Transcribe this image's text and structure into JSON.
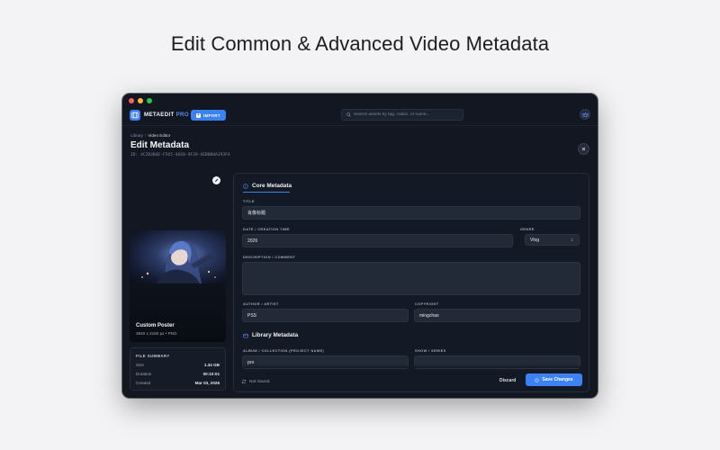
{
  "headline": "Edit Common & Advanced Video Metadata",
  "app": {
    "name_main": "METAEDIT",
    "name_pro": " PRO",
    "import_label": "IMPORT",
    "search_placeholder": "Search assets by tag, codec, or name..."
  },
  "breadcrumb": {
    "root": "Library",
    "separator": "/",
    "current": "Video Editor"
  },
  "page": {
    "title": "Edit Metadata",
    "id_text": "ID: 4C2B3B4E-F565-46E0-9F39-AEB8B8A393FA"
  },
  "poster": {
    "title": "Custom Poster",
    "subtitle": "3840 x 2160 px • PNG"
  },
  "file_summary": {
    "heading": "FILE SUMMARY",
    "rows": [
      {
        "key": "Size",
        "value": "1.34 GB"
      },
      {
        "key": "Duration",
        "value": "00:10:01"
      },
      {
        "key": "Created",
        "value": "Mar 03, 2026"
      }
    ]
  },
  "core": {
    "heading": "Core Metadata",
    "title_label": "TITLE",
    "title_value": "肖像标题",
    "date_label": "DATE / CREATION TIME",
    "date_value": "2026",
    "genre_label": "GENRE",
    "genre_value": "Vlog",
    "description_label": "DESCRIPTION / COMMENT",
    "description_value": "",
    "author_label": "AUTHOR / ARTIST",
    "author_value": "PSS",
    "copyright_label": "COPYRIGHT",
    "copyright_value": "mingchao"
  },
  "library": {
    "heading": "Library Metadata",
    "album_label": "ALBUM / COLLECTION (PROJECT NAME)",
    "album_value": "pro",
    "show_label": "SHOW / SERIES",
    "show_value": ""
  },
  "footer": {
    "status": "Not Saved",
    "discard": "Discard",
    "save": "Save Changes"
  },
  "colors": {
    "accent": "#3b82f6",
    "window_bg": "#121722",
    "panel_bg": "#141a25",
    "field_bg": "#222a37"
  }
}
